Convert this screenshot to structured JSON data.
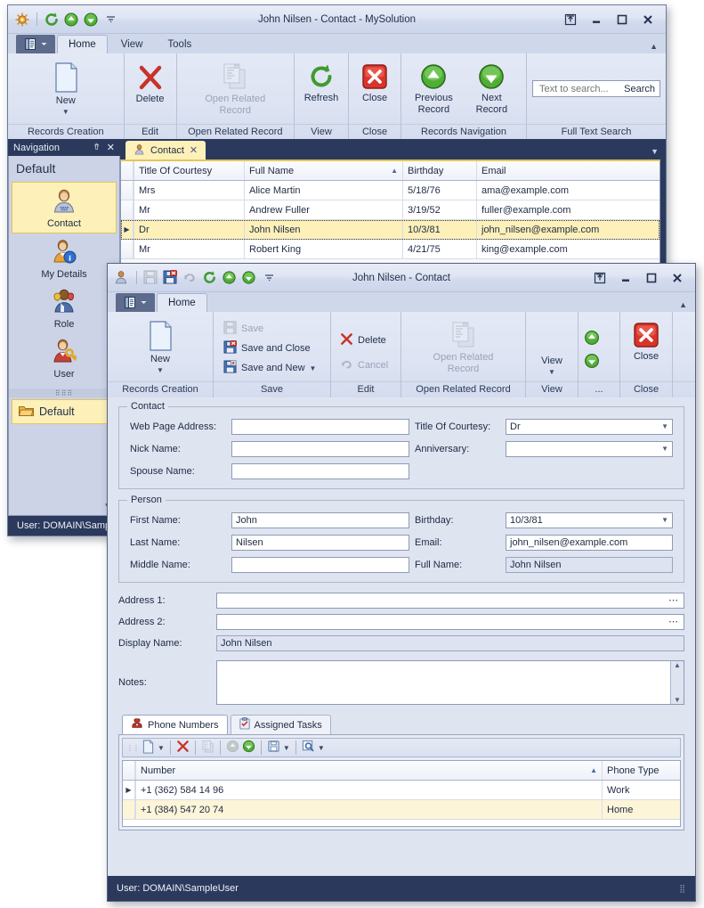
{
  "main_window": {
    "title": "John Nilsen - Contact - MySolution",
    "quick_access": [
      {
        "name": "app-logo-icon",
        "label": "MySolution"
      },
      {
        "name": "refresh-icon",
        "label": "Refresh"
      },
      {
        "name": "previous-record-icon",
        "label": "Previous Record"
      },
      {
        "name": "next-record-icon",
        "label": "Next Record"
      },
      {
        "name": "customize-quick-access-icon",
        "label": "Customize Quick Access Toolbar"
      }
    ],
    "window_buttons": [
      {
        "name": "restore-layout-button",
        "label": "Restore Layout"
      },
      {
        "name": "minimize-button",
        "label": "Minimize"
      },
      {
        "name": "maximize-button",
        "label": "Maximize"
      },
      {
        "name": "close-button",
        "label": "Close"
      }
    ],
    "ribbon_tabs": [
      {
        "label": "Home",
        "selected": true
      },
      {
        "label": "View",
        "selected": false
      },
      {
        "label": "Tools",
        "selected": false
      }
    ],
    "ribbon_groups": [
      {
        "caption": "Records Creation",
        "buttons": [
          {
            "label": "New",
            "icon": "new-document-icon",
            "disabled": false,
            "dropdown": true
          }
        ]
      },
      {
        "caption": "Edit",
        "buttons": [
          {
            "label": "Delete",
            "icon": "delete-x-icon",
            "disabled": false,
            "dropdown": false
          }
        ]
      },
      {
        "caption": "Open Related Record",
        "buttons": [
          {
            "label": "Open Related Record",
            "icon": "open-related-record-icon",
            "disabled": true,
            "dropdown": false
          }
        ]
      },
      {
        "caption": "View",
        "buttons": [
          {
            "label": "Refresh",
            "icon": "refresh-icon",
            "disabled": false,
            "dropdown": false
          }
        ]
      },
      {
        "caption": "Close",
        "buttons": [
          {
            "label": "Close",
            "icon": "close-red-icon",
            "disabled": false,
            "dropdown": false
          }
        ]
      },
      {
        "caption": "Records Navigation",
        "buttons": [
          {
            "label": "Previous Record",
            "icon": "arrow-up-green-icon",
            "disabled": false,
            "dropdown": false
          },
          {
            "label": "Next Record",
            "icon": "arrow-down-green-icon",
            "disabled": false,
            "dropdown": false
          }
        ]
      },
      {
        "caption": "Full Text Search",
        "buttons": []
      }
    ],
    "search": {
      "placeholder": "Text to search...",
      "value": "",
      "button_label": "Search"
    },
    "status": "User: DOMAIN\\Sampl"
  },
  "navigation": {
    "header_title": "Navigation",
    "pin_icon": "pin-icon",
    "close_icon": "close-icon",
    "group_title": "Default",
    "items": [
      {
        "label": "Contact",
        "icon": "contact-person-icon",
        "selected": true
      },
      {
        "label": "My Details",
        "icon": "my-details-person-info-icon",
        "selected": false
      },
      {
        "label": "Role",
        "icon": "role-masks-icon",
        "selected": false
      },
      {
        "label": "User",
        "icon": "user-key-icon",
        "selected": false
      }
    ],
    "footer_group": {
      "label": "Default",
      "icon": "folder-icon",
      "selected": true
    },
    "expand_icon": "chevron-down-icon"
  },
  "document_tabs": [
    {
      "label": "Contact",
      "icon": "contact-person-icon",
      "selected": true,
      "closable": true
    }
  ],
  "document_tabs_overflow_icon": "chevron-down-icon",
  "contacts_grid": {
    "columns": [
      {
        "label": "Title Of Courtesy",
        "sorted": false
      },
      {
        "label": "Full Name",
        "sorted": true,
        "sort_dir": "asc"
      },
      {
        "label": "Birthday",
        "sorted": false
      },
      {
        "label": "Email",
        "sorted": false
      }
    ],
    "rows": [
      {
        "selected": false,
        "current": false,
        "cells": [
          "Mrs",
          "Alice Martin",
          "5/18/76",
          "ama@example.com"
        ]
      },
      {
        "selected": false,
        "current": false,
        "cells": [
          "Mr",
          "Andrew Fuller",
          "3/19/52",
          "fuller@example.com"
        ]
      },
      {
        "selected": true,
        "current": true,
        "cells": [
          "Dr",
          "John Nilsen",
          "10/3/81",
          "john_nilsen@example.com"
        ]
      },
      {
        "selected": false,
        "current": false,
        "cells": [
          "Mr",
          "Robert King",
          "4/21/75",
          "king@example.com"
        ]
      }
    ]
  },
  "detail_window": {
    "title": "John Nilsen - Contact",
    "quick_access": [
      {
        "name": "contact-icon",
        "label": "Contact"
      },
      {
        "name": "save-icon",
        "label": "Save",
        "disabled": true
      },
      {
        "name": "save-and-close-icon",
        "label": "Save and Close"
      },
      {
        "name": "undo-icon",
        "label": "Cancel",
        "disabled": true
      },
      {
        "name": "refresh-icon",
        "label": "Refresh"
      },
      {
        "name": "previous-record-icon",
        "label": "Previous Record"
      },
      {
        "name": "next-record-icon",
        "label": "Next Record"
      },
      {
        "name": "customize-quick-access-icon",
        "label": "Customize Quick Access Toolbar"
      }
    ],
    "window_buttons": [
      {
        "name": "restore-layout-button",
        "label": "Restore Layout"
      },
      {
        "name": "minimize-button",
        "label": "Minimize"
      },
      {
        "name": "maximize-button",
        "label": "Maximize"
      },
      {
        "name": "close-button",
        "label": "Close"
      }
    ],
    "ribbon_tabs": [
      {
        "label": "Home",
        "selected": true
      }
    ],
    "ribbon_groups": {
      "records_creation": {
        "caption": "Records Creation",
        "new_label": "New"
      },
      "save": {
        "caption": "Save",
        "items": [
          {
            "label": "Save",
            "icon": "save-icon",
            "disabled": true,
            "dropdown": false
          },
          {
            "label": "Save and Close",
            "icon": "save-and-close-icon",
            "disabled": false,
            "dropdown": false
          },
          {
            "label": "Save and New",
            "icon": "save-and-new-icon",
            "disabled": false,
            "dropdown": true
          }
        ]
      },
      "edit": {
        "caption": "Edit",
        "items": [
          {
            "label": "Delete",
            "icon": "delete-x-icon",
            "disabled": false
          },
          {
            "label": "Cancel",
            "icon": "undo-icon",
            "disabled": true
          }
        ]
      },
      "open_related": {
        "caption": "Open Related Record",
        "label": "Open Related Record",
        "disabled": true
      },
      "view": {
        "caption": "View",
        "label": "View"
      },
      "navigation": {
        "caption": "...",
        "items": [
          {
            "label": "Previous Record",
            "icon": "arrow-up-green-icon"
          },
          {
            "label": "Next Record",
            "icon": "arrow-down-green-icon"
          }
        ]
      },
      "close": {
        "caption": "Close",
        "label": "Close",
        "icon": "close-red-icon"
      }
    },
    "contact_group": {
      "legend": "Contact",
      "fields": [
        {
          "label": "Web Page Address:",
          "value": "",
          "type": "text"
        },
        {
          "label": "Nick Name:",
          "value": "",
          "type": "text"
        },
        {
          "label": "Spouse Name:",
          "value": "",
          "type": "text"
        },
        {
          "label": "Title Of Courtesy:",
          "value": "Dr",
          "type": "combo"
        },
        {
          "label": "Anniversary:",
          "value": "",
          "type": "combo"
        }
      ]
    },
    "person_group": {
      "legend": "Person",
      "fields": [
        {
          "label": "First Name:",
          "value": "John",
          "type": "text"
        },
        {
          "label": "Last Name:",
          "value": "Nilsen",
          "type": "text"
        },
        {
          "label": "Middle Name:",
          "value": "",
          "type": "text"
        },
        {
          "label": "Birthday:",
          "value": "10/3/81",
          "type": "combo"
        },
        {
          "label": "Email:",
          "value": "john_nilsen@example.com",
          "type": "text"
        },
        {
          "label": "Full Name:",
          "value": "John Nilsen",
          "type": "readonly"
        }
      ]
    },
    "address_fields": [
      {
        "label": "Address 1:",
        "value": "",
        "type": "ellipsis"
      },
      {
        "label": "Address 2:",
        "value": "",
        "type": "ellipsis"
      },
      {
        "label": "Display Name:",
        "value": "John Nilsen",
        "type": "readonly"
      }
    ],
    "notes": {
      "label": "Notes:",
      "value": ""
    },
    "bottom_tabs": [
      {
        "label": "Phone Numbers",
        "icon": "phone-icon",
        "selected": true
      },
      {
        "label": "Assigned Tasks",
        "icon": "clipboard-task-icon",
        "selected": false
      }
    ],
    "phone_toolbar": [
      {
        "name": "new-record-icon",
        "label": "New",
        "dropdown": true,
        "disabled": false
      },
      {
        "name": "delete-x-icon",
        "label": "Delete",
        "dropdown": false,
        "disabled": false
      },
      {
        "name": "open-related-record-icon",
        "label": "Open Related Record",
        "dropdown": false,
        "disabled": true
      },
      {
        "name": "arrow-up-green-icon",
        "label": "Previous Record",
        "dropdown": false,
        "disabled": true
      },
      {
        "name": "arrow-down-green-icon",
        "label": "Next Record",
        "dropdown": false,
        "disabled": false
      },
      {
        "name": "export-icon",
        "label": "Export",
        "dropdown": true,
        "disabled": false
      },
      {
        "name": "search-magnifier-icon",
        "label": "Find",
        "dropdown": true,
        "disabled": false
      }
    ],
    "phone_grid": {
      "columns": [
        {
          "label": "Number",
          "sorted": true,
          "sort_dir": "asc"
        },
        {
          "label": "Phone Type",
          "sorted": false
        }
      ],
      "rows": [
        {
          "current": true,
          "highlight": false,
          "cells": [
            "+1 (362) 584 14 96",
            "Work"
          ]
        },
        {
          "current": false,
          "highlight": true,
          "cells": [
            "+1 (384) 547 20 74",
            "Home"
          ]
        }
      ]
    },
    "status": "User: DOMAIN\\SampleUser"
  },
  "colors": {
    "accent_dark": "#2b3a5c",
    "ribbon_bg": "#dfe4f1",
    "selection_yellow": "#fdf0b9",
    "green": "#3f9b30",
    "red": "#c8322a"
  }
}
